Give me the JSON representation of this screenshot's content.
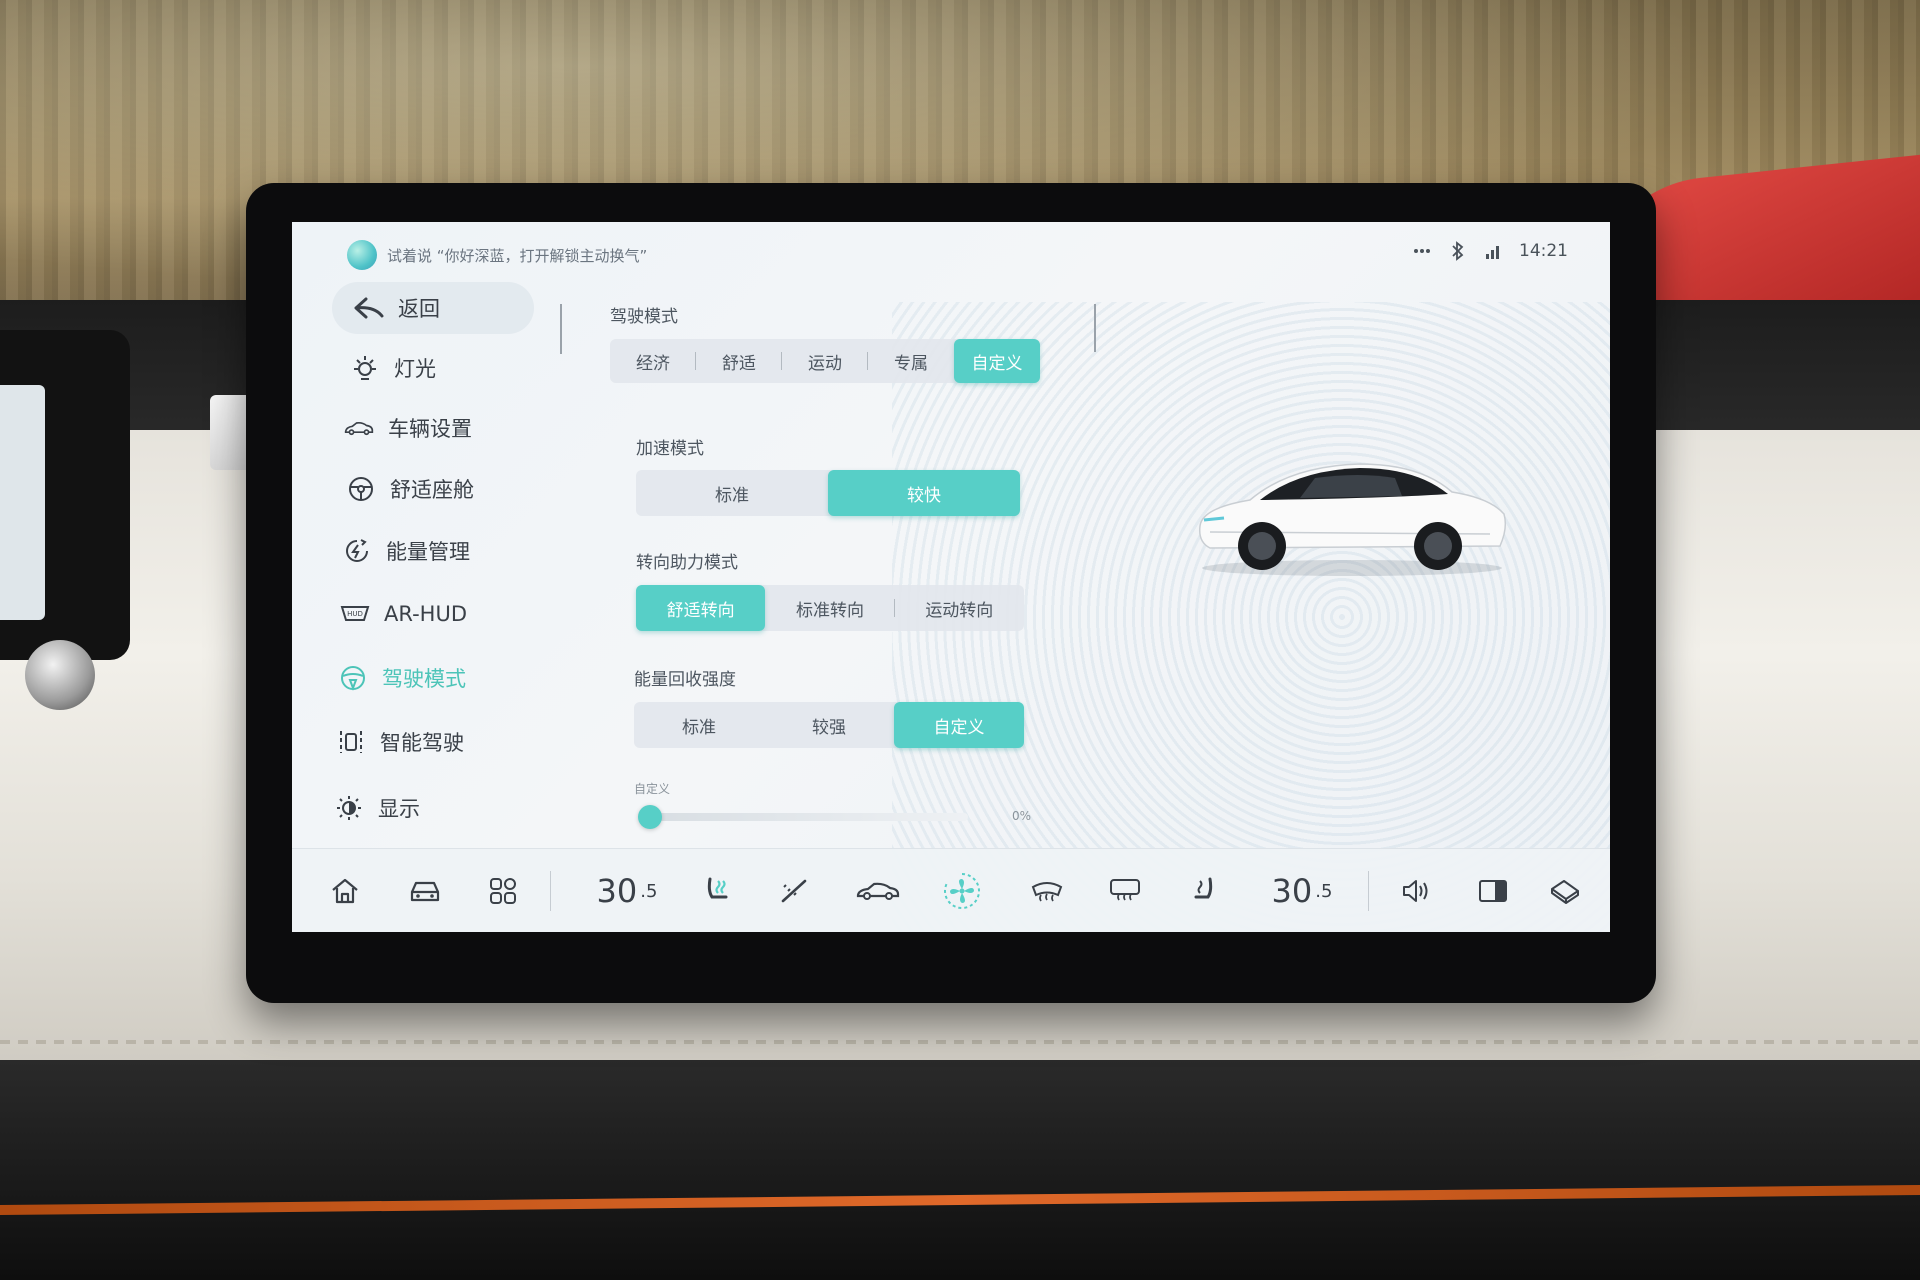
{
  "status_bar": {
    "assistant_hint": "试着说 “你好深蓝，打开解锁主动换气”",
    "more_icon": "more-dots-icon",
    "bluetooth_icon": "bluetooth-icon",
    "signal_icon": "signal-icon",
    "time": "14:21"
  },
  "sidebar": {
    "back_label": "返回",
    "items": [
      {
        "label": "灯光",
        "icon": "light-icon"
      },
      {
        "label": "车辆设置",
        "icon": "car-icon"
      },
      {
        "label": "舒适座舱",
        "icon": "steering-wheel-icon"
      },
      {
        "label": "能量管理",
        "icon": "energy-icon"
      },
      {
        "label": "AR-HUD",
        "icon": "hud-icon"
      },
      {
        "label": "驾驶模式",
        "icon": "drive-mode-icon",
        "active": true
      },
      {
        "label": "智能驾驶",
        "icon": "smart-drive-icon"
      },
      {
        "label": "显示",
        "icon": "display-icon"
      }
    ]
  },
  "drive_mode": {
    "title": "驾驶模式",
    "modes": [
      "经济",
      "舒适",
      "运动",
      "专属",
      "自定义"
    ],
    "selected_mode": "自定义",
    "acceleration": {
      "label": "加速模式",
      "options": [
        "标准",
        "较快"
      ],
      "selected": "较快"
    },
    "steering": {
      "label": "转向助力模式",
      "options": [
        "舒适转向",
        "标准转向",
        "运动转向"
      ],
      "selected": "舒适转向"
    },
    "regen": {
      "label": "能量回收强度",
      "options": [
        "标准",
        "较强",
        "自定义"
      ],
      "selected": "自定义",
      "custom_label": "自定义",
      "custom_value": "0%",
      "custom_fraction": 0
    }
  },
  "dock": {
    "home_icon": "home-icon",
    "car_icon": "car-outline-icon",
    "apps_icon": "apps-grid-icon",
    "driver_temp_int": "30",
    "driver_temp_dec": ".5",
    "driver_seat_icon": "seat-heat-icon",
    "wiper_icon": "wiper-icon",
    "car_side_icon": "car-side-icon",
    "fan_icon": "fan-icon",
    "defrost_front_icon": "front-defrost-icon",
    "defrost_rear_icon": "rear-defrost-icon",
    "passenger_seat_icon": "passenger-seat-icon",
    "passenger_temp_int": "30",
    "passenger_temp_dec": ".5",
    "volume_icon": "volume-icon",
    "split_screen_icon": "split-screen-icon",
    "eraser_icon": "clean-icon",
    "accent_color": "#57cfc7"
  }
}
